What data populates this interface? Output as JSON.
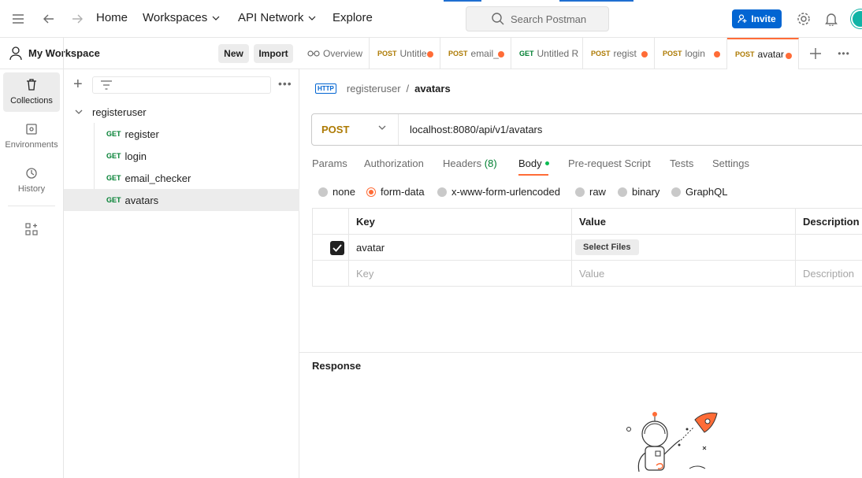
{
  "header": {
    "nav": {
      "home": "Home",
      "workspaces": "Workspaces",
      "api_network": "API Network",
      "explore": "Explore"
    },
    "search_placeholder": "Search Postman",
    "invite_label": "Invite"
  },
  "workspace": {
    "name": "My Workspace",
    "new_label": "New",
    "import_label": "Import"
  },
  "rail": {
    "collections": "Collections",
    "environments": "Environments",
    "history": "History"
  },
  "collection": {
    "name": "registeruser",
    "items": [
      {
        "method": "GET",
        "name": "register"
      },
      {
        "method": "GET",
        "name": "login"
      },
      {
        "method": "GET",
        "name": "email_checker"
      },
      {
        "method": "GET",
        "name": "avatars"
      }
    ]
  },
  "tabs": [
    {
      "method": "",
      "label": "Overview",
      "dot": false
    },
    {
      "method": "POST",
      "label": "Untitle",
      "dot": true
    },
    {
      "method": "POST",
      "label": "email_",
      "dot": true
    },
    {
      "method": "GET",
      "label": "Untitled R",
      "dot": false
    },
    {
      "method": "POST",
      "label": "regist",
      "dot": true
    },
    {
      "method": "POST",
      "label": "login",
      "dot": true
    },
    {
      "method": "POST",
      "label": "avatar",
      "dot": true
    }
  ],
  "request": {
    "breadcrumb_parent": "registeruser",
    "breadcrumb_sep": "/",
    "breadcrumb_current": "avatars",
    "http_badge": "HTTP",
    "method": "POST",
    "url": "localhost:8080/api/v1/avatars",
    "tabs": {
      "params": "Params",
      "authorization": "Authorization",
      "headers": "Headers",
      "headers_count": "(8)",
      "body": "Body",
      "prerequest": "Pre-request Script",
      "tests": "Tests",
      "settings": "Settings"
    },
    "body_types": {
      "none": "none",
      "form_data": "form-data",
      "urlencoded": "x-www-form-urlencoded",
      "raw": "raw",
      "binary": "binary",
      "graphql": "GraphQL"
    },
    "table": {
      "key_header": "Key",
      "value_header": "Value",
      "description_header": "Description",
      "row_key": "avatar",
      "row_value_button": "Select Files",
      "placeholder_key": "Key",
      "placeholder_value": "Value",
      "placeholder_description": "Description"
    }
  },
  "response": {
    "title": "Response"
  },
  "colors": {
    "accent": "#ff6c37",
    "invite": "#0265d2",
    "get": "#007f31",
    "post": "#ad7a03"
  }
}
